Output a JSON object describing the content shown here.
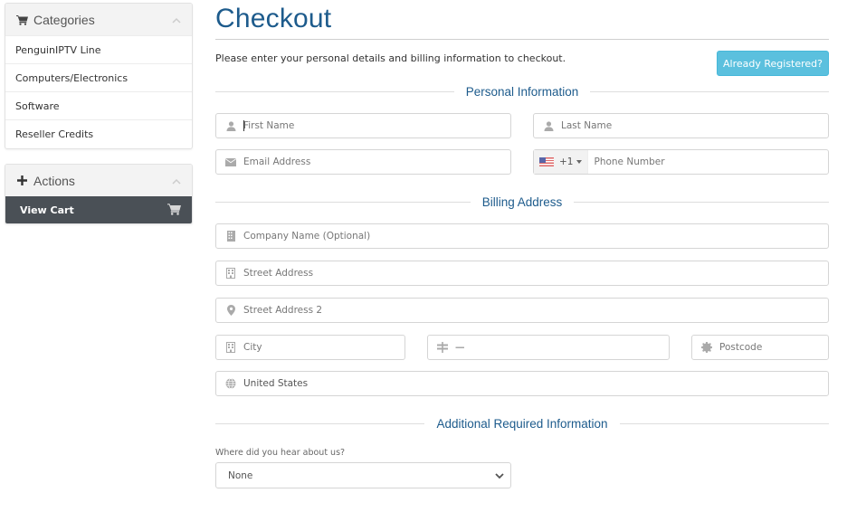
{
  "sidebar": {
    "categories": {
      "title": "Categories",
      "icon": "cart-icon",
      "items": [
        {
          "label": "PenguinIPTV Line"
        },
        {
          "label": "Computers/Electronics"
        },
        {
          "label": "Software"
        },
        {
          "label": "Reseller Credits"
        }
      ]
    },
    "actions": {
      "title": "Actions",
      "icon": "plus-icon",
      "items": [
        {
          "label": "View Cart",
          "icon": "cart-icon"
        }
      ]
    }
  },
  "main": {
    "title": "Checkout",
    "intro": "Please enter your personal details and billing information to checkout.",
    "already_registered_label": "Already Registered?",
    "sections": {
      "personal": "Personal Information",
      "billing": "Billing Address",
      "additional": "Additional Required Information"
    },
    "fields": {
      "first_name": {
        "placeholder": "First Name",
        "value": "",
        "icon": "user-icon"
      },
      "last_name": {
        "placeholder": "Last Name",
        "value": "",
        "icon": "user-icon"
      },
      "email": {
        "placeholder": "Email Address",
        "value": "",
        "icon": "envelope-icon"
      },
      "phone": {
        "placeholder": "Phone Number",
        "value": "",
        "country_flag": "us-flag-icon",
        "dial_code": "+1"
      },
      "company": {
        "placeholder": "Company Name (Optional)",
        "value": "",
        "icon": "building-icon"
      },
      "street": {
        "placeholder": "Street Address",
        "value": "",
        "icon": "building-icon"
      },
      "street2": {
        "placeholder": "Street Address 2",
        "value": "",
        "icon": "map-marker-icon"
      },
      "city": {
        "placeholder": "City",
        "value": "",
        "icon": "building-icon"
      },
      "state": {
        "placeholder": "",
        "value": "—",
        "icon": "signpost-icon"
      },
      "postcode": {
        "placeholder": "Postcode",
        "value": "",
        "icon": "certificate-icon"
      },
      "country": {
        "placeholder": "",
        "value": "United States",
        "icon": "globe-icon"
      }
    },
    "hear_about": {
      "label": "Where did you hear about us?",
      "selected": "None"
    }
  },
  "colors": {
    "accent": "#1d5b8c",
    "info_button": "#5bc0de",
    "dark_item": "#4a5056"
  }
}
